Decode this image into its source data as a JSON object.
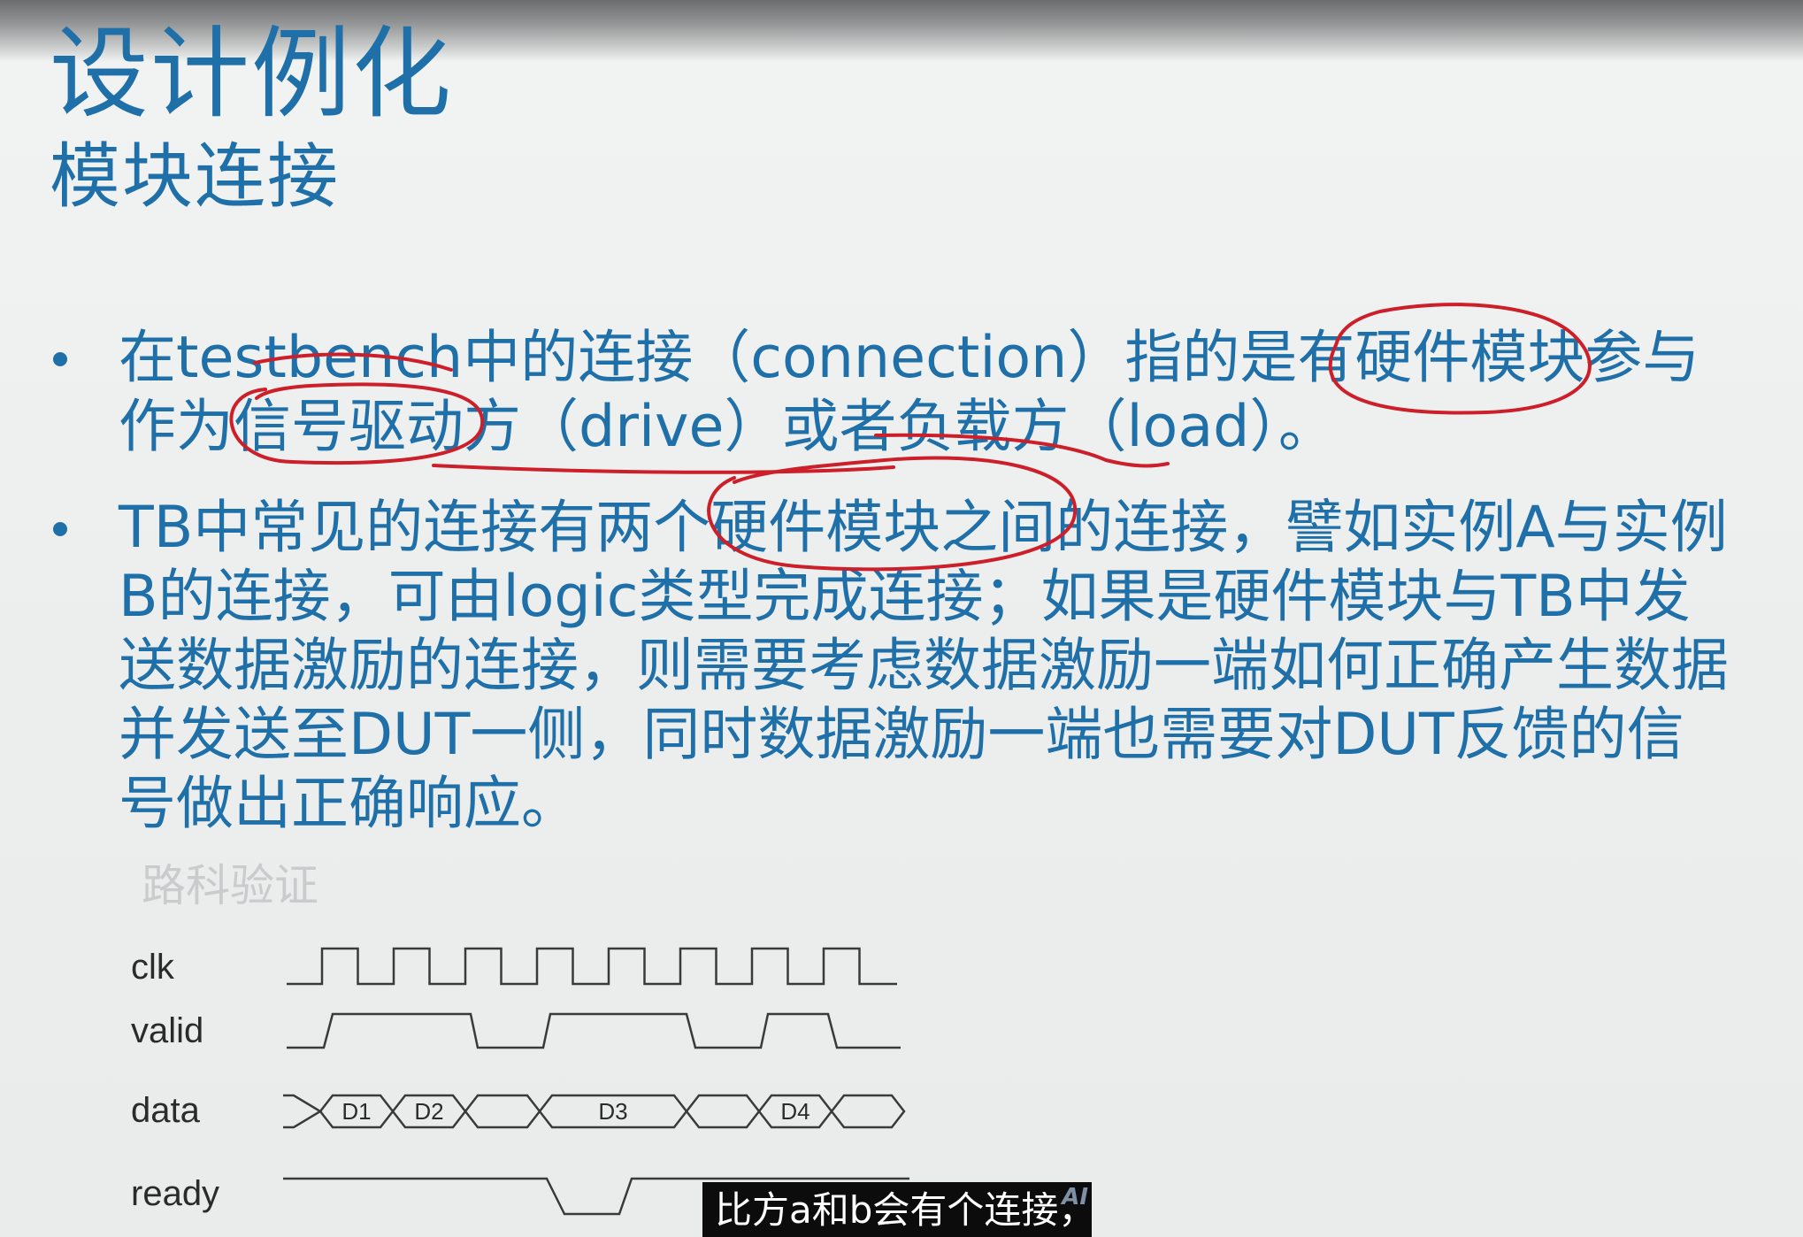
{
  "slide": {
    "title": "设计例化",
    "subtitle": "模块连接",
    "bullets": [
      "在testbench中的连接（connection）指的是有硬件模块参与\n作为信号驱动方（drive）或者负载方（load）。",
      "TB中常见的连接有两个硬件模块之间的连接，譬如实例A与实例\nB的连接，可由logic类型完成连接；如果是硬件模块与TB中发\n送数据激励的连接，则需要考虑数据激励一端如何正确产生数据\n并发送至DUT一侧，同时数据激励一端也需要对DUT反馈的信\n号做出正确响应。"
    ],
    "watermark": "路科验证"
  },
  "timing_diagram": {
    "signals": [
      "clk",
      "valid",
      "data",
      "ready"
    ],
    "clk_cycles": 8,
    "data_labels": [
      "D1",
      "D2",
      "",
      "D3",
      "",
      "D4",
      ""
    ]
  },
  "video_caption": {
    "text": "比方a和b会有个连接，",
    "badge": "AI"
  },
  "colors": {
    "text_blue": "#1f6fa8",
    "annotation_red": "#cc1f2a",
    "wave_gray": "#3a3a3a",
    "caption_bg": "#0c0c0c"
  }
}
